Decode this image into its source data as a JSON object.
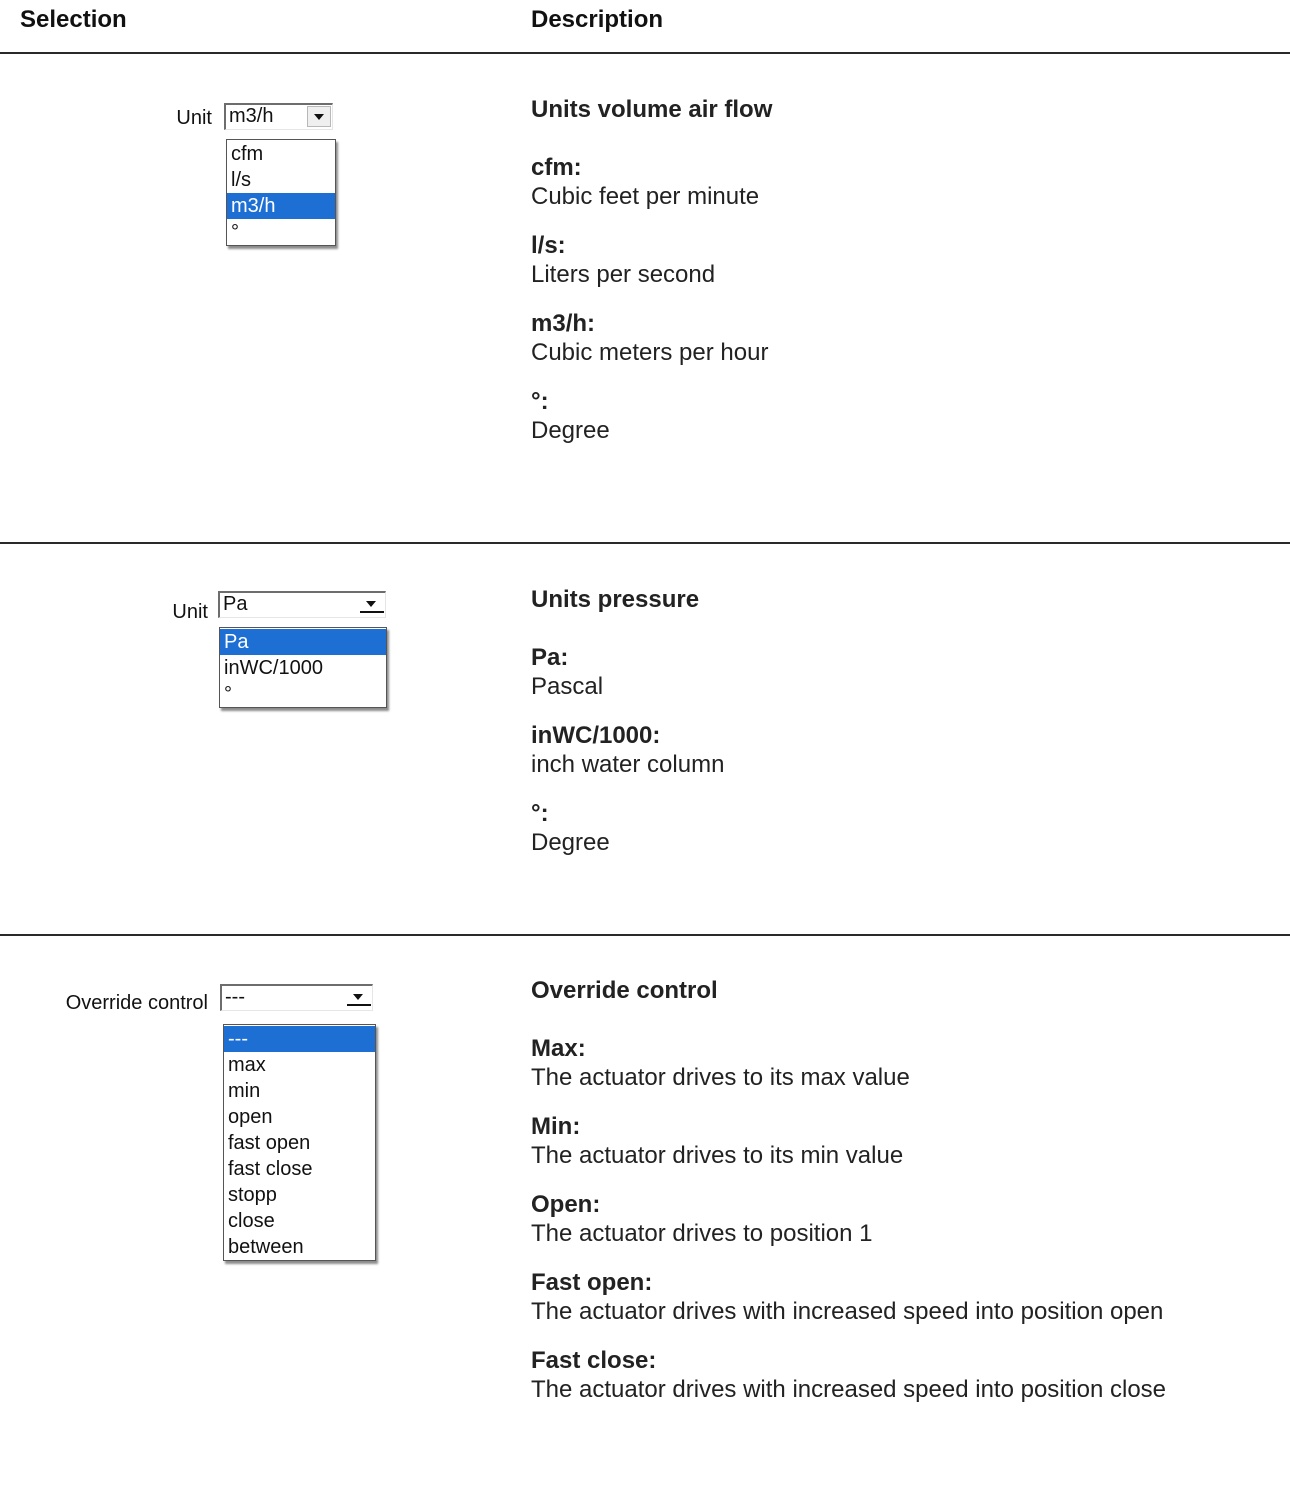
{
  "header": {
    "selection": "Selection",
    "description": "Description"
  },
  "sections": [
    {
      "label": "Unit",
      "combo_value": "m3/h",
      "options": [
        "cfm",
        "l/s",
        "m3/h",
        "°"
      ],
      "selected": 2,
      "title": "Units volume air flow",
      "items": [
        {
          "key": "cfm:",
          "value": "Cubic feet per minute"
        },
        {
          "key": "l/s:",
          "value": "Liters per second"
        },
        {
          "key": "m3/h:",
          "value": "Cubic meters per hour"
        },
        {
          "key": "°:",
          "value": "Degree"
        }
      ]
    },
    {
      "label": "Unit",
      "combo_value": "Pa",
      "options": [
        "Pa",
        "inWC/1000",
        "°"
      ],
      "selected": 0,
      "title": "Units pressure",
      "items": [
        {
          "key": "Pa:",
          "value": "Pascal"
        },
        {
          "key": "inWC/1000:",
          "value": "inch water column"
        },
        {
          "key": "°:",
          "value": "Degree"
        }
      ]
    },
    {
      "label": "Override control",
      "combo_value": "---",
      "options": [
        "---",
        "max",
        "min",
        "open",
        "fast open",
        "fast close",
        "stopp",
        "close",
        "between"
      ],
      "selected": 0,
      "title": "Override control",
      "items": [
        {
          "key": "Max:",
          "value": "The actuator drives to its max value"
        },
        {
          "key": "Min:",
          "value": "The actuator drives to its min value"
        },
        {
          "key": "Open:",
          "value": "The actuator drives to position 1"
        },
        {
          "key": "Fast open:",
          "value": "The actuator drives with increased speed into position open"
        },
        {
          "key": "Fast close:",
          "value": "The actuator drives with increased speed into position close"
        }
      ]
    }
  ],
  "colors": {
    "selection_highlight": "#1d6fd4",
    "rule": "#2a2a2a"
  }
}
